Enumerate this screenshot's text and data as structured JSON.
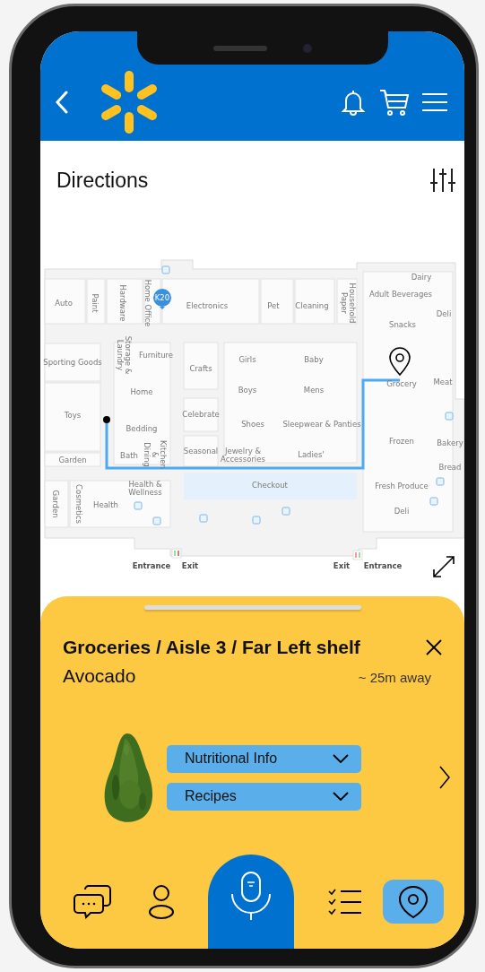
{
  "screen_title": "Directions",
  "map": {
    "badge": "K20",
    "departments": [
      {
        "lines": [
          "Auto"
        ],
        "vertical": false
      },
      {
        "lines": [
          "Paint"
        ],
        "vertical": true
      },
      {
        "lines": [
          "Hardware"
        ],
        "vertical": true
      },
      {
        "lines": [
          "Home Office"
        ],
        "vertical": true
      },
      {
        "lines": [
          "Electronics"
        ],
        "vertical": false
      },
      {
        "lines": [
          "Pet"
        ],
        "vertical": false
      },
      {
        "lines": [
          "Cleaning"
        ],
        "vertical": false
      },
      {
        "lines": [
          "Household",
          "Paper"
        ],
        "vertical": true
      },
      {
        "lines": [
          "Dairy"
        ],
        "vertical": false
      },
      {
        "lines": [
          "Adult Beverages"
        ],
        "vertical": false
      },
      {
        "lines": [
          "Deli"
        ],
        "vertical": false
      },
      {
        "lines": [
          "Snacks"
        ],
        "vertical": false
      },
      {
        "lines": [
          "Sporting Goods"
        ],
        "vertical": false
      },
      {
        "lines": [
          "Storage &",
          "Laundry"
        ],
        "vertical": true
      },
      {
        "lines": [
          "Furniture"
        ],
        "vertical": false
      },
      {
        "lines": [
          "Crafts"
        ],
        "vertical": false
      },
      {
        "lines": [
          "Girls"
        ],
        "vertical": false
      },
      {
        "lines": [
          "Baby"
        ],
        "vertical": false
      },
      {
        "lines": [
          "Grocery"
        ],
        "vertical": false
      },
      {
        "lines": [
          "Meat"
        ],
        "vertical": false
      },
      {
        "lines": [
          "Home"
        ],
        "vertical": false
      },
      {
        "lines": [
          "Boys"
        ],
        "vertical": false
      },
      {
        "lines": [
          "Mens"
        ],
        "vertical": false
      },
      {
        "lines": [
          "Toys"
        ],
        "vertical": false
      },
      {
        "lines": [
          "Bedding"
        ],
        "vertical": false
      },
      {
        "lines": [
          "Celebrate"
        ],
        "vertical": false
      },
      {
        "lines": [
          "Shoes"
        ],
        "vertical": false
      },
      {
        "lines": [
          "Sleepwear & Panties"
        ],
        "vertical": false
      },
      {
        "lines": [
          "Frozen"
        ],
        "vertical": false
      },
      {
        "lines": [
          "Bakery"
        ],
        "vertical": false
      },
      {
        "lines": [
          "Garden"
        ],
        "vertical": false
      },
      {
        "lines": [
          "Bath"
        ],
        "vertical": false
      },
      {
        "lines": [
          "Kitchen",
          "&",
          "Dining"
        ],
        "vertical": true
      },
      {
        "lines": [
          "Seasonal"
        ],
        "vertical": false
      },
      {
        "lines": [
          "Jewelry &",
          "Accessories"
        ],
        "vertical": false
      },
      {
        "lines": [
          "Ladies'"
        ],
        "vertical": false
      },
      {
        "lines": [
          "Bread"
        ],
        "vertical": false
      },
      {
        "lines": [
          "Health &",
          "Wellness"
        ],
        "vertical": false
      },
      {
        "lines": [
          "Checkout"
        ],
        "vertical": false
      },
      {
        "lines": [
          "Fresh Produce"
        ],
        "vertical": false
      },
      {
        "lines": [
          "Garden"
        ],
        "vertical": true
      },
      {
        "lines": [
          "Cosmetics"
        ],
        "vertical": true
      },
      {
        "lines": [
          "Health"
        ],
        "vertical": false
      },
      {
        "lines": [
          "Deli"
        ],
        "vertical": false
      }
    ],
    "doors": [
      "Entrance",
      "Exit",
      "Exit",
      "Entrance"
    ]
  },
  "sheet": {
    "location": "Groceries / Aisle 3 / Far Left shelf",
    "product": "Avocado",
    "distance": "~ 25m away",
    "buttons": [
      {
        "label": "Nutritional Info"
      },
      {
        "label": "Recipes"
      }
    ]
  },
  "nav": [
    {
      "kind": "chat",
      "selected": false
    },
    {
      "kind": "profile",
      "selected": false
    },
    {
      "kind": "voice",
      "selected": false
    },
    {
      "kind": "checklist",
      "selected": false
    },
    {
      "kind": "location",
      "selected": true
    }
  ]
}
